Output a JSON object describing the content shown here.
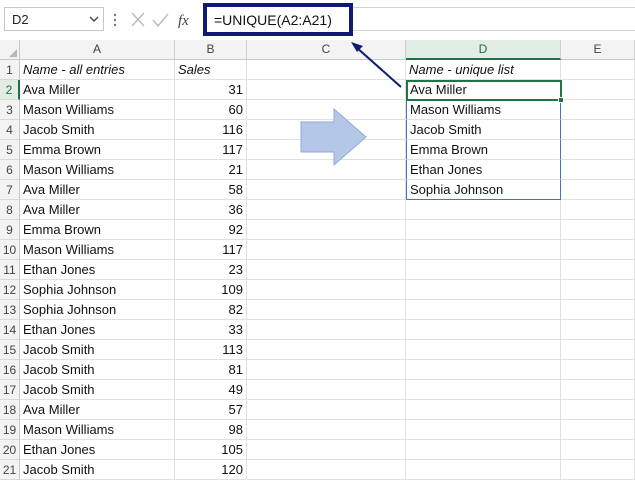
{
  "toolbar": {
    "name_box": "D2",
    "formula": "=UNIQUE(A2:A21)",
    "fx_label": "fx"
  },
  "columns": [
    "A",
    "B",
    "C",
    "D",
    "E"
  ],
  "selected_column": "D",
  "selected_row": 2,
  "rows": [
    "1",
    "2",
    "3",
    "4",
    "5",
    "6",
    "7",
    "8",
    "9",
    "10",
    "11",
    "12",
    "13",
    "14",
    "15",
    "16",
    "17",
    "18",
    "19",
    "20",
    "21"
  ],
  "headers": {
    "names": "Name - all entries",
    "sales": "Sales",
    "unique": "Name - unique list"
  },
  "entries": [
    {
      "name": "Ava Miller",
      "sales": "31"
    },
    {
      "name": "Mason Williams",
      "sales": "60"
    },
    {
      "name": "Jacob Smith",
      "sales": "116"
    },
    {
      "name": "Emma Brown",
      "sales": "117"
    },
    {
      "name": "Mason Williams",
      "sales": "21"
    },
    {
      "name": "Ava Miller",
      "sales": "58"
    },
    {
      "name": "Ava Miller",
      "sales": "36"
    },
    {
      "name": "Emma Brown",
      "sales": "92"
    },
    {
      "name": "Mason Williams",
      "sales": "117"
    },
    {
      "name": "Ethan Jones",
      "sales": "23"
    },
    {
      "name": "Sophia Johnson",
      "sales": "109"
    },
    {
      "name": "Sophia Johnson",
      "sales": "82"
    },
    {
      "name": "Ethan Jones",
      "sales": "33"
    },
    {
      "name": "Jacob Smith",
      "sales": "113"
    },
    {
      "name": "Jacob Smith",
      "sales": "81"
    },
    {
      "name": "Jacob Smith",
      "sales": "49"
    },
    {
      "name": "Ava Miller",
      "sales": "57"
    },
    {
      "name": "Mason Williams",
      "sales": "98"
    },
    {
      "name": "Ethan Jones",
      "sales": "105"
    },
    {
      "name": "Jacob Smith",
      "sales": "120"
    }
  ],
  "unique_list": [
    "Ava Miller",
    "Mason Williams",
    "Jacob Smith",
    "Emma Brown",
    "Ethan Jones",
    "Sophia Johnson"
  ],
  "icons": {
    "name_box_dropdown": "chevron-down-icon",
    "cancel": "x-icon",
    "enter": "check-icon",
    "insert_function": "fx-icon",
    "flow": "right-arrow-icon",
    "callout": "pointer-arrow-icon"
  },
  "colors": {
    "selection_green": "#217346",
    "callout_navy": "#0e1a73",
    "list_border": "#4472c4",
    "arrow_fill": "#b4c7e7",
    "arrow_stroke": "#8faadc"
  }
}
